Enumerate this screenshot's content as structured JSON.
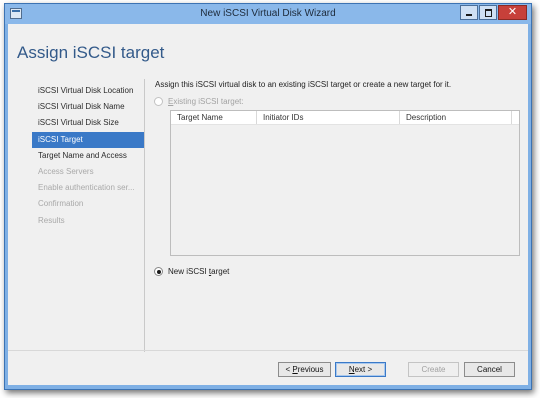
{
  "window": {
    "title": "New iSCSI Virtual Disk Wizard",
    "close_glyph": "✕"
  },
  "page": {
    "title": "Assign iSCSI target",
    "instruction": "Assign this iSCSI virtual disk to an existing iSCSI target or create a new target for it."
  },
  "nav": {
    "items": [
      {
        "label": "iSCSI Virtual Disk Location",
        "state": "normal"
      },
      {
        "label": "iSCSI Virtual Disk Name",
        "state": "normal"
      },
      {
        "label": "iSCSI Virtual Disk Size",
        "state": "normal"
      },
      {
        "label": "iSCSI Target",
        "state": "selected"
      },
      {
        "label": "Target Name and Access",
        "state": "normal"
      },
      {
        "label": "Access Servers",
        "state": "disabled"
      },
      {
        "label": "Enable authentication ser...",
        "state": "disabled"
      },
      {
        "label": "Confirmation",
        "state": "disabled"
      },
      {
        "label": "Results",
        "state": "disabled"
      }
    ]
  },
  "options": {
    "existing": {
      "pre": "",
      "accel": "E",
      "post": "xisting iSCSI target:",
      "checked": false,
      "enabled": false
    },
    "new": {
      "pre": "New iSCSI ",
      "accel": "t",
      "post": "arget",
      "checked": true,
      "enabled": true
    }
  },
  "targets_table": {
    "columns": [
      "Target Name",
      "Initiator IDs",
      "Description"
    ],
    "rows": []
  },
  "buttons": {
    "previous": {
      "pre": "< ",
      "accel": "P",
      "post": "revious"
    },
    "next": {
      "pre": "",
      "accel": "N",
      "post": "ext >"
    },
    "create": {
      "label": "Create"
    },
    "cancel": {
      "label": "Cancel"
    }
  },
  "colors": {
    "titlebar": "#8ab8ea",
    "accent_selected": "#3a79c7",
    "page_title": "#335a8a",
    "close_button": "#c7403a"
  },
  "icons": {
    "app": "wizard-app-icon",
    "minimize": "minimize-icon",
    "maximize": "maximize-icon",
    "close": "close-icon"
  }
}
